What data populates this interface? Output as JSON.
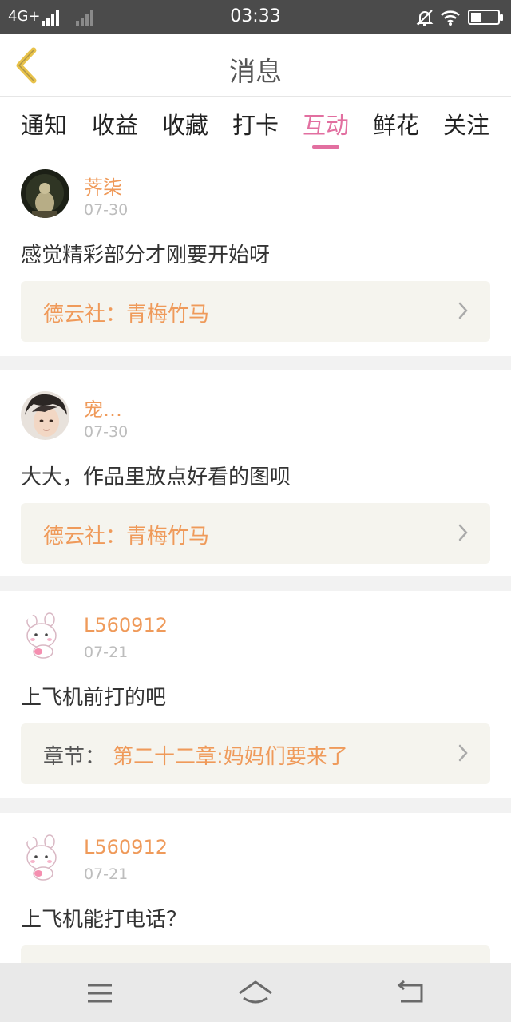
{
  "status_bar": {
    "network": "4G+",
    "time": "03:33"
  },
  "header": {
    "title": "消息"
  },
  "tabs": [
    {
      "label": "通知",
      "active": false
    },
    {
      "label": "收益",
      "active": false
    },
    {
      "label": "收藏",
      "active": false
    },
    {
      "label": "打卡",
      "active": false
    },
    {
      "label": "互动",
      "active": true
    },
    {
      "label": "鲜花",
      "active": false
    },
    {
      "label": "关注",
      "active": false
    }
  ],
  "messages": [
    {
      "username": "荠柒",
      "date": "07-30",
      "content": "感觉精彩部分才刚要开始呀",
      "ref_prefix": "",
      "ref_text": "德云社：青梅竹马"
    },
    {
      "username": "宠…",
      "date": "07-30",
      "content": "大大，作品里放点好看的图呗",
      "ref_prefix": "",
      "ref_text": "德云社：青梅竹马"
    },
    {
      "username": "L560912",
      "date": "07-21",
      "content": "上飞机前打的吧",
      "ref_prefix": "章节：",
      "ref_text": "第二十二章:妈妈们要来了"
    },
    {
      "username": "L560912",
      "date": "07-21",
      "content": "上飞机能打电话？",
      "ref_prefix": "",
      "ref_text": ""
    }
  ],
  "colors": {
    "accent_tab": "#e26fa0",
    "username": "#ef9a5a",
    "ref_background": "#f5f4ee"
  },
  "icons": {
    "back": "chevron-left-icon",
    "ref_arrow": "chevron-right-icon",
    "nav_menu": "menu-icon",
    "nav_home": "home-icon",
    "nav_back": "return-icon"
  }
}
